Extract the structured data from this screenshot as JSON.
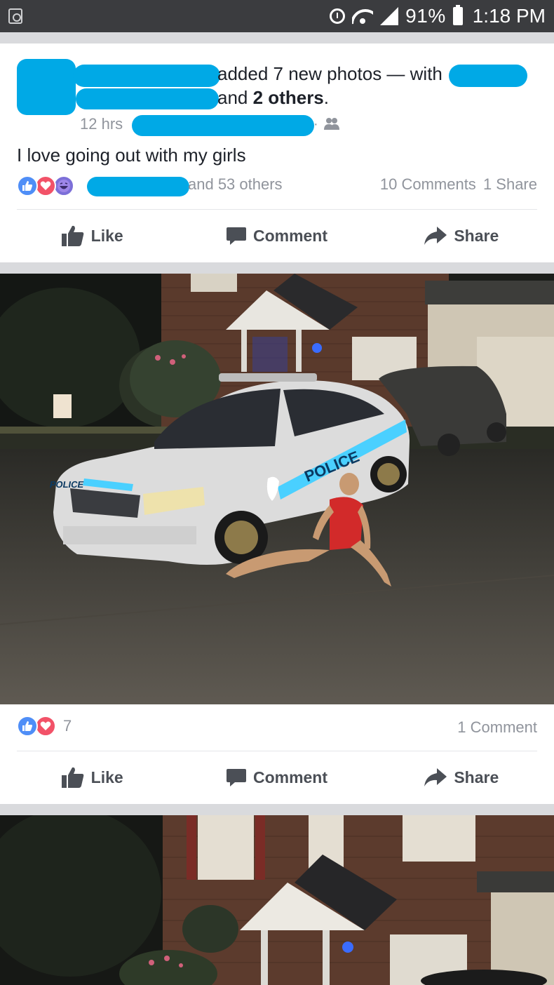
{
  "status_bar": {
    "battery_pct": "91%",
    "time": "1:18 PM",
    "icons": [
      "notification-icon",
      "alarm-icon",
      "wifi-icon",
      "signal-icon",
      "battery-icon"
    ]
  },
  "post": {
    "action_text": "added 7 new photos — with",
    "and_text": "and",
    "others_text": "2 others",
    "period": ".",
    "timestamp": "12 hrs",
    "dot": "·",
    "body": "I love going out with my girls",
    "reaction_others": "and 53 others",
    "comments": "10 Comments",
    "shares": "1 Share"
  },
  "photo_post": {
    "reaction_count": "7",
    "comments": "1 Comment"
  },
  "actions": {
    "like": "Like",
    "comment": "Comment",
    "share": "Share"
  },
  "photo_text": {
    "hood_label": "POLICE",
    "door_label": "POLICE"
  },
  "colors": {
    "redaction": "#00a9e6",
    "like_blue": "#4f8ef7",
    "love_red": "#f25268",
    "text_dark": "#1d2129",
    "text_muted": "#90949c",
    "action_gray": "#4b4f56"
  }
}
